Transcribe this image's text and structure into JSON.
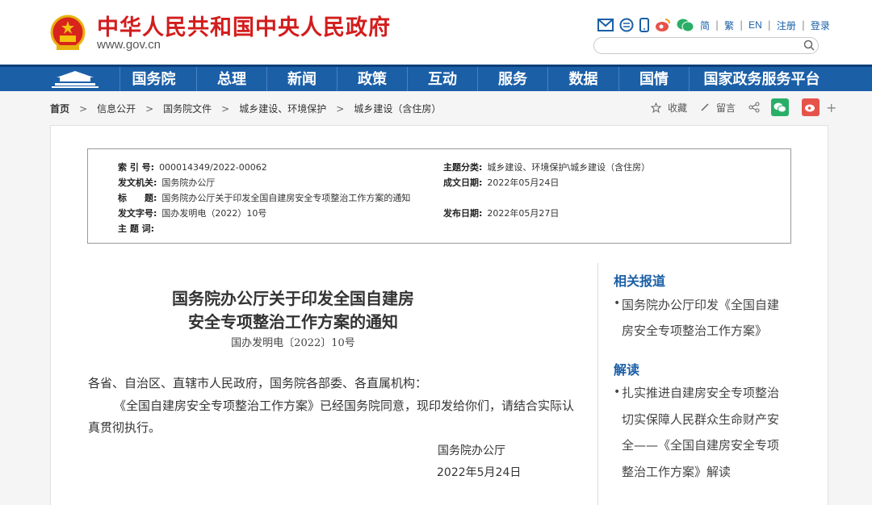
{
  "header": {
    "site_title": "中华人民共和国中央人民政府",
    "site_url": "www.gov.cn",
    "lang_links": [
      "简",
      "繁",
      "EN",
      "注册",
      "登录"
    ],
    "icons": [
      "mail-icon",
      "app-icon",
      "mobile-icon",
      "weibo-icon",
      "wechat-icon"
    ],
    "search_placeholder": ""
  },
  "nav": {
    "items": [
      "国务院",
      "总理",
      "新闻",
      "政策",
      "互动",
      "服务",
      "数据",
      "国情",
      "国家政务服务平台"
    ]
  },
  "breadcrumb": {
    "items": [
      "首页",
      "信息公开",
      "国务院文件",
      "城乡建设、环境保护",
      "城乡建设（含住房）"
    ],
    "separator": ">"
  },
  "share": {
    "favorite": "收藏",
    "comment": "留言",
    "plus": "+"
  },
  "meta": {
    "index_label": "索 引 号:",
    "index_value": "000014349/2022-00062",
    "topic_label": "主题分类:",
    "topic_value": "城乡建设、环境保护\\城乡建设（含住房）",
    "issuer_label": "发文机关:",
    "issuer_value": "国务院办公厅",
    "date_label": "成文日期:",
    "date_value": "2022年05月24日",
    "title_label": "标　　题:",
    "title_value": "国务院办公厅关于印发全国自建房安全专项整治工作方案的通知",
    "docno_label": "发文字号:",
    "docno_value": "国办发明电（2022）10号",
    "pub_label": "发布日期:",
    "pub_value": "2022年05月27日",
    "keyword_label": "主 题 词:",
    "keyword_value": ""
  },
  "document": {
    "title_line1": "国务院办公厅关于印发全国自建房",
    "title_line2": "安全专项整治工作方案的通知",
    "number": "国办发明电〔2022〕10号",
    "salutation": "各省、自治区、直辖市人民政府，国务院各部委、各直属机构：",
    "para1": "《全国自建房安全专项整治工作方案》已经国务院同意，现印发给你们，请结合实际认",
    "para1_cont": "真贯彻执行。",
    "signer": "国务院办公厅",
    "sign_date": "2022年5月24日"
  },
  "sidebar": {
    "related_heading": "相关报道",
    "related_lines": [
      "国务院办公厅印发《全国自建",
      "房安全专项整治工作方案》"
    ],
    "interpret_heading": "解读",
    "interpret_lines": [
      "扎实推进自建房安全专项整治",
      "切实保障人民群众生命财产安",
      "全——《全国自建房安全专项",
      "整治工作方案》解读"
    ]
  },
  "colors": {
    "brand_red": "#d21d1d",
    "nav_blue": "#1b5fa7",
    "wechat_green": "#2aae67",
    "weibo_red": "#e6534b"
  }
}
